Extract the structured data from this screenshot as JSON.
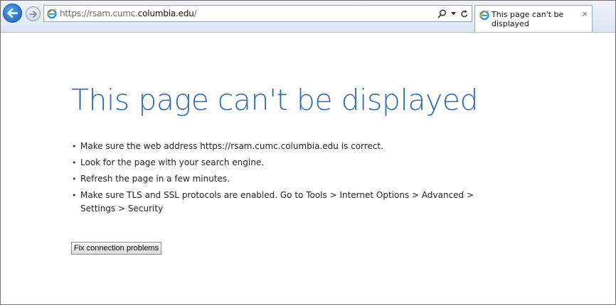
{
  "browser": {
    "address": {
      "prefix": "https://rsam.cumc.",
      "domain": "columbia.edu",
      "suffix": "/"
    },
    "tab": {
      "title": "This page can't be displayed",
      "close_glyph": "×"
    },
    "icons": {
      "back": "back-arrow-icon",
      "forward": "forward-arrow-icon",
      "site": "ie-logo-icon",
      "search": "search-icon",
      "dropdown": "dropdown-icon",
      "refresh": "refresh-icon",
      "close": "close-icon"
    },
    "colors": {
      "accent": "#1a5fb4",
      "title": "#2e6db5"
    }
  },
  "page": {
    "title": "This page can't be displayed",
    "tips": [
      "Make sure the web address https://rsam.cumc.columbia.edu is correct.",
      "Look for the page with your search engine.",
      "Refresh the page in a few minutes.",
      "Make sure TLS and SSL protocols are enabled. Go to Tools > Internet Options > Advanced > Settings > Security"
    ],
    "fix_button_label": "Fix connection problems"
  }
}
